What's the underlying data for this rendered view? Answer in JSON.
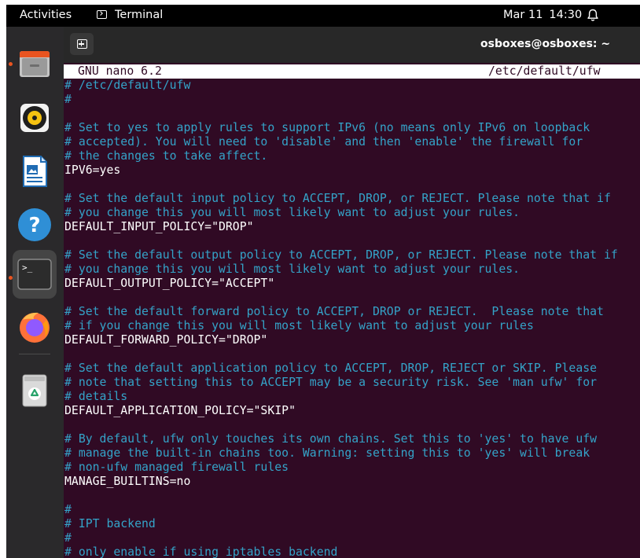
{
  "topbar": {
    "activities": "Activities",
    "app_name": "Terminal",
    "date": "Mar 11",
    "time": "14:30"
  },
  "dock": {
    "items": [
      {
        "name": "Files",
        "icon": "files-icon",
        "running": true
      },
      {
        "name": "Rhythmbox",
        "icon": "rhythmbox-icon",
        "running": false
      },
      {
        "name": "LibreOffice Writer",
        "icon": "writer-icon",
        "running": false
      },
      {
        "name": "Help",
        "icon": "help-icon",
        "running": false
      },
      {
        "name": "Terminal",
        "icon": "terminal-icon",
        "running": true,
        "active": true
      },
      {
        "name": "Firefox",
        "icon": "firefox-icon",
        "running": false
      },
      {
        "name": "Trash",
        "icon": "trash-icon",
        "running": false
      }
    ]
  },
  "terminal": {
    "title": "osboxes@osboxes: ~"
  },
  "nano": {
    "version": "GNU nano 6.2",
    "filename": "/etc/default/ufw",
    "lines": [
      {
        "type": "comment",
        "text": "# /etc/default/ufw"
      },
      {
        "type": "comment",
        "text": "#"
      },
      {
        "type": "blank",
        "text": ""
      },
      {
        "type": "comment",
        "text": "# Set to yes to apply rules to support IPv6 (no means only IPv6 on loopback"
      },
      {
        "type": "comment",
        "text": "# accepted). You will need to 'disable' and then 'enable' the firewall for"
      },
      {
        "type": "comment",
        "text": "# the changes to take affect."
      },
      {
        "type": "code",
        "text": "IPV6=yes"
      },
      {
        "type": "blank",
        "text": ""
      },
      {
        "type": "comment",
        "text": "# Set the default input policy to ACCEPT, DROP, or REJECT. Please note that if"
      },
      {
        "type": "comment",
        "text": "# you change this you will most likely want to adjust your rules."
      },
      {
        "type": "code",
        "text": "DEFAULT_INPUT_POLICY=\"DROP\""
      },
      {
        "type": "blank",
        "text": ""
      },
      {
        "type": "comment",
        "text": "# Set the default output policy to ACCEPT, DROP, or REJECT. Please note that if"
      },
      {
        "type": "comment",
        "text": "# you change this you will most likely want to adjust your rules."
      },
      {
        "type": "code",
        "text": "DEFAULT_OUTPUT_POLICY=\"ACCEPT\""
      },
      {
        "type": "blank",
        "text": ""
      },
      {
        "type": "comment",
        "text": "# Set the default forward policy to ACCEPT, DROP or REJECT.  Please note that"
      },
      {
        "type": "comment",
        "text": "# if you change this you will most likely want to adjust your rules"
      },
      {
        "type": "code",
        "text": "DEFAULT_FORWARD_POLICY=\"DROP\""
      },
      {
        "type": "blank",
        "text": ""
      },
      {
        "type": "comment",
        "text": "# Set the default application policy to ACCEPT, DROP, REJECT or SKIP. Please"
      },
      {
        "type": "comment",
        "text": "# note that setting this to ACCEPT may be a security risk. See 'man ufw' for"
      },
      {
        "type": "comment",
        "text": "# details"
      },
      {
        "type": "code",
        "text": "DEFAULT_APPLICATION_POLICY=\"SKIP\""
      },
      {
        "type": "blank",
        "text": ""
      },
      {
        "type": "comment",
        "text": "# By default, ufw only touches its own chains. Set this to 'yes' to have ufw"
      },
      {
        "type": "comment",
        "text": "# manage the built-in chains too. Warning: setting this to 'yes' will break"
      },
      {
        "type": "comment",
        "text": "# non-ufw managed firewall rules"
      },
      {
        "type": "code",
        "text": "MANAGE_BUILTINS=no"
      },
      {
        "type": "blank",
        "text": ""
      },
      {
        "type": "comment",
        "text": "#"
      },
      {
        "type": "comment",
        "text": "# IPT backend"
      },
      {
        "type": "comment",
        "text": "#"
      },
      {
        "type": "comment",
        "text": "# only enable if using iptables backend"
      }
    ]
  },
  "colors": {
    "terminal_bg": "#300a24",
    "comment": "#34a3c8",
    "code": "#ffffff",
    "dock_bg": "#2a292b",
    "running_indicator": "#e95420"
  }
}
